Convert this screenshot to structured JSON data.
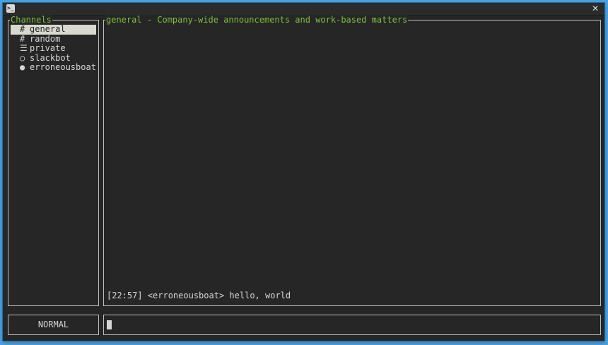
{
  "window": {
    "term_icon": ">_",
    "close_glyph": "✕"
  },
  "channels": {
    "title": "Channels",
    "items": [
      {
        "glyph": "#",
        "label": "general",
        "selected": true
      },
      {
        "glyph": "#",
        "label": "random",
        "selected": false
      },
      {
        "glyph": "☰",
        "label": "private",
        "selected": false
      },
      {
        "glyph": "○",
        "label": "slackbot",
        "selected": false
      },
      {
        "glyph": "●",
        "label": "erroneousboat",
        "selected": false
      }
    ]
  },
  "messages": {
    "title": "general - Company-wide announcements and work-based matters",
    "lines": [
      {
        "time": "[22:57]",
        "user": "<erroneousboat>",
        "text": "hello, world"
      }
    ]
  },
  "mode": {
    "label": "NORMAL"
  },
  "input": {
    "value": "",
    "placeholder": ""
  },
  "colors": {
    "background": "#262626",
    "border": "#bdbdbd",
    "title_accent": "#7bbf3a",
    "selection_bg": "#d8d8d0",
    "desktop": "#4aa3e6"
  }
}
